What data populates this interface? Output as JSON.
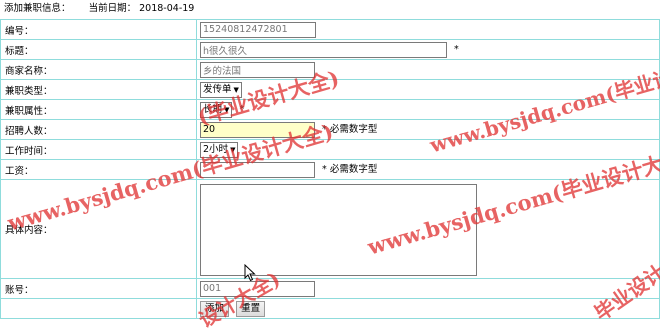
{
  "header": {
    "label": "添加兼职信息：",
    "date_label": "当前日期：",
    "date": "2018-04-19"
  },
  "fields": {
    "id": {
      "label": "编号：",
      "value": "15240812472801"
    },
    "title": {
      "label": "标题：",
      "value": "h很久很久",
      "required": "*"
    },
    "merchant": {
      "label": "商家名称：",
      "value": "乡的法国"
    },
    "type": {
      "label": "兼职类型：",
      "selected": "发传单"
    },
    "attr": {
      "label": "兼职属性：",
      "selected": "长期",
      "required": "*"
    },
    "headcount": {
      "label": "招聘人数：",
      "value": "20",
      "note": "* 必需数字型"
    },
    "worktime": {
      "label": "工作时间：",
      "selected": "2小时"
    },
    "wage": {
      "label": "工资：",
      "value": "",
      "note": "* 必需数字型"
    },
    "content": {
      "label": "具体内容：",
      "value": ""
    },
    "account": {
      "label": "账号：",
      "value": "001"
    }
  },
  "buttons": {
    "add": "添加",
    "reset": "重置"
  },
  "watermarks": {
    "a": "www.bysjdq.com(毕业设计大全)",
    "b": "(毕业设计大全)",
    "c": "设计大全)",
    "d": "毕业设计大全)"
  },
  "colors": {
    "border": "#8fdcdc",
    "watermark": "#e03030",
    "highlight": "#ffffc8"
  }
}
